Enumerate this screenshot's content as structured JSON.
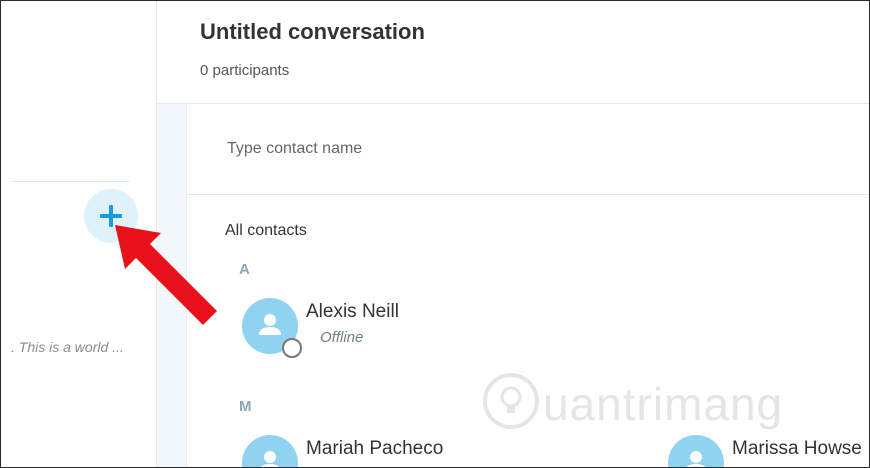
{
  "sidebar": {
    "add_label": "+",
    "preview_text": ". This is a world ..."
  },
  "conversation": {
    "title": "Untitled conversation",
    "participants": "0 participants"
  },
  "search": {
    "placeholder": "Type contact name"
  },
  "contacts": {
    "heading": "All contacts",
    "groups": [
      {
        "letter": "A",
        "items": [
          {
            "name": "Alexis Neill",
            "status": "Offline"
          }
        ]
      },
      {
        "letter": "M",
        "items": [
          {
            "name": "Mariah Pacheco"
          },
          {
            "name": "Marissa Howse"
          }
        ]
      }
    ]
  },
  "watermark": {
    "text": "uantrimang"
  },
  "colors": {
    "accent": "#1a9ae0",
    "avatar": "#8fd3f0",
    "add_button_bg": "#dff2fb",
    "arrow": "#e8121b"
  }
}
